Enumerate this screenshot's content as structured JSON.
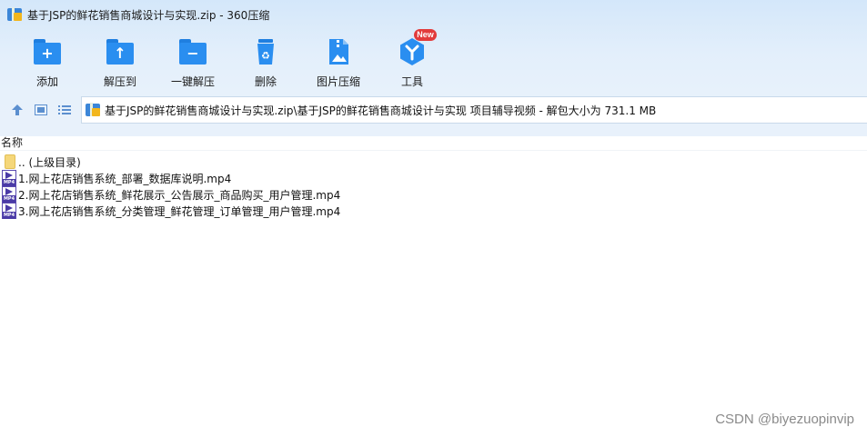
{
  "window": {
    "title": "基于JSP的鲜花销售商城设计与实现.zip - 360压缩"
  },
  "toolbar": {
    "items": [
      {
        "label": "添加",
        "icon": "add-folder-icon"
      },
      {
        "label": "解压到",
        "icon": "extract-to-icon"
      },
      {
        "label": "一键解压",
        "icon": "one-click-extract-icon"
      },
      {
        "label": "删除",
        "icon": "delete-icon"
      },
      {
        "label": "图片压缩",
        "icon": "image-compress-icon"
      },
      {
        "label": "工具",
        "icon": "tools-icon",
        "badge": "New"
      }
    ]
  },
  "address_bar": {
    "path": "基于JSP的鲜花销售商城设计与实现.zip\\基于JSP的鲜花销售商城设计与实现 项目辅导视频 - 解包大小为 731.1 MB"
  },
  "file_list": {
    "column_header": "名称",
    "items": [
      {
        "name": ".. (上级目录)",
        "type": "parent-folder"
      },
      {
        "name": "1.网上花店销售系统_部署_数据库说明.mp4",
        "type": "mp4"
      },
      {
        "name": "2.网上花店销售系统_鲜花展示_公告展示_商品购买_用户管理.mp4",
        "type": "mp4"
      },
      {
        "name": "3.网上花店销售系统_分类管理_鲜花管理_订单管理_用户管理.mp4",
        "type": "mp4"
      }
    ]
  },
  "watermark": "CSDN @biyezuopinvip",
  "colors": {
    "accent": "#2a8ef0",
    "badge": "#e23b3b",
    "video_icon": "#4a3aa6"
  }
}
